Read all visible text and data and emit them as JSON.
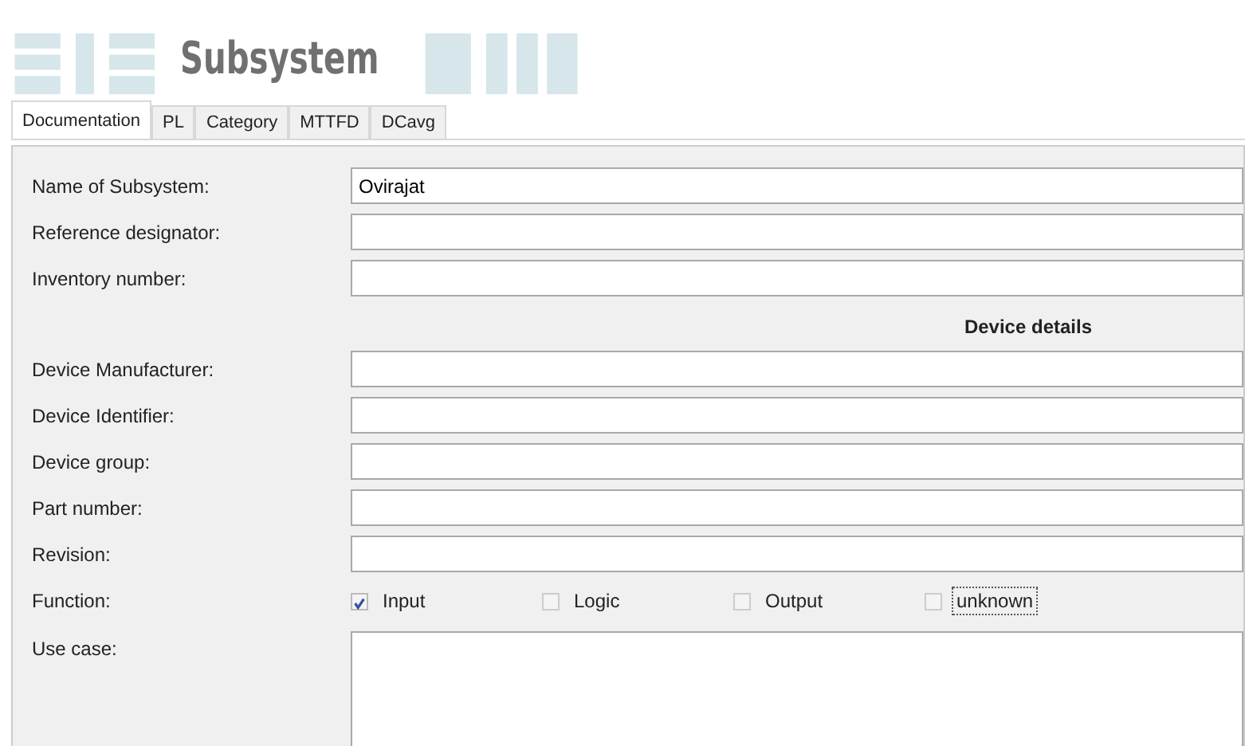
{
  "header": {
    "title": "Subsystem"
  },
  "tabs": [
    {
      "label": "Documentation",
      "selected": true
    },
    {
      "label": "PL",
      "selected": false
    },
    {
      "label": "Category",
      "selected": false
    },
    {
      "label": "MTTFD",
      "selected": false
    },
    {
      "label": "DCavg",
      "selected": false
    }
  ],
  "fields_top": [
    {
      "label": "Name of Subsystem:",
      "value": "Ovirajat"
    },
    {
      "label": "Reference designator:"
    },
    {
      "label": "Inventory number:"
    }
  ],
  "section_heading": "Device details",
  "fields_device": [
    {
      "label": "Device Manufacturer:"
    },
    {
      "label": "Device Identifier:"
    },
    {
      "label": "Device group:"
    },
    {
      "label": "Part number:"
    },
    {
      "label": "Revision:"
    }
  ],
  "function": {
    "label": "Function:",
    "options": [
      {
        "label": "Input",
        "checked": true,
        "focused": false
      },
      {
        "label": "Logic",
        "checked": false,
        "focused": false
      },
      {
        "label": "Output",
        "checked": false,
        "focused": false
      },
      {
        "label": "unknown",
        "checked": false,
        "focused": true
      }
    ]
  },
  "use_case": {
    "label": "Use case:"
  }
}
